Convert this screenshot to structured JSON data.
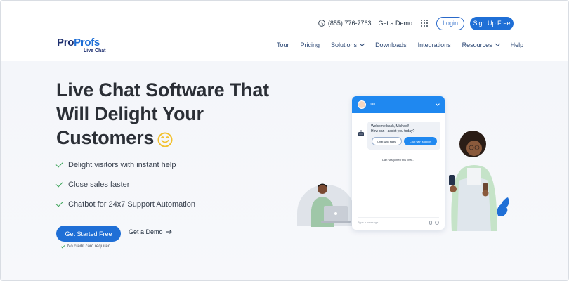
{
  "topbar": {
    "phone": "(855) 776-7763",
    "get_demo": "Get a Demo",
    "login": "Login",
    "signup": "Sign Up Free"
  },
  "logo": {
    "pro": "Pro",
    "profs": "Profs",
    "sub": "Live Chat"
  },
  "nav": {
    "items": [
      {
        "label": "Tour",
        "dropdown": false
      },
      {
        "label": "Pricing",
        "dropdown": false
      },
      {
        "label": "Solutions",
        "dropdown": true
      },
      {
        "label": "Downloads",
        "dropdown": false
      },
      {
        "label": "Integrations",
        "dropdown": false
      },
      {
        "label": "Resources",
        "dropdown": true
      },
      {
        "label": "Help",
        "dropdown": false
      }
    ]
  },
  "hero": {
    "title_line1": "Live Chat Software That",
    "title_line2": "Will Delight Your",
    "title_line3": "Customers",
    "features": [
      "Delight visitors with instant help",
      "Close sales faster",
      "Chatbot for 24x7 Support Automation"
    ],
    "cta": "Get Started Free",
    "cta_demo": "Get a Demo",
    "note": "No credit card required."
  },
  "chat_widget": {
    "agent": "Dan",
    "greeting_line1": "Welcome back, Michael!",
    "greeting_line2": "How can I assist you today?",
    "option_sales": "Chat with sales",
    "option_support": "Chat with support",
    "joined": "Dan has joined this chat...",
    "input_placeholder": "Type a message..."
  },
  "colors": {
    "primary": "#1f6fd6",
    "chat_header": "#1f88f0",
    "brand_dark": "#1d2e6e",
    "check_green": "#3aa356",
    "emoji_yellow": "#f2c12e"
  }
}
